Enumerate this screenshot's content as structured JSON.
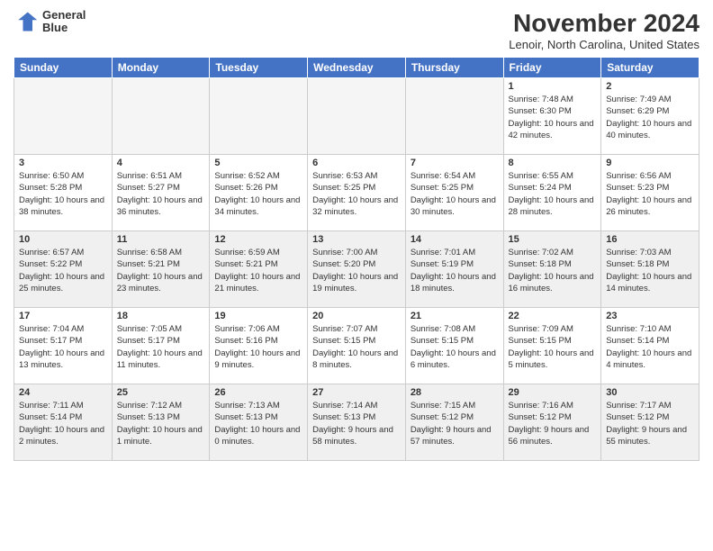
{
  "header": {
    "logo_line1": "General",
    "logo_line2": "Blue",
    "main_title": "November 2024",
    "sub_title": "Lenoir, North Carolina, United States"
  },
  "weekdays": [
    "Sunday",
    "Monday",
    "Tuesday",
    "Wednesday",
    "Thursday",
    "Friday",
    "Saturday"
  ],
  "weeks": [
    [
      {
        "day": "",
        "info": "",
        "empty": true
      },
      {
        "day": "",
        "info": "",
        "empty": true
      },
      {
        "day": "",
        "info": "",
        "empty": true
      },
      {
        "day": "",
        "info": "",
        "empty": true
      },
      {
        "day": "",
        "info": "",
        "empty": true
      },
      {
        "day": "1",
        "info": "Sunrise: 7:48 AM\nSunset: 6:30 PM\nDaylight: 10 hours\nand 42 minutes."
      },
      {
        "day": "2",
        "info": "Sunrise: 7:49 AM\nSunset: 6:29 PM\nDaylight: 10 hours\nand 40 minutes."
      }
    ],
    [
      {
        "day": "3",
        "info": "Sunrise: 6:50 AM\nSunset: 5:28 PM\nDaylight: 10 hours\nand 38 minutes."
      },
      {
        "day": "4",
        "info": "Sunrise: 6:51 AM\nSunset: 5:27 PM\nDaylight: 10 hours\nand 36 minutes."
      },
      {
        "day": "5",
        "info": "Sunrise: 6:52 AM\nSunset: 5:26 PM\nDaylight: 10 hours\nand 34 minutes."
      },
      {
        "day": "6",
        "info": "Sunrise: 6:53 AM\nSunset: 5:25 PM\nDaylight: 10 hours\nand 32 minutes."
      },
      {
        "day": "7",
        "info": "Sunrise: 6:54 AM\nSunset: 5:25 PM\nDaylight: 10 hours\nand 30 minutes."
      },
      {
        "day": "8",
        "info": "Sunrise: 6:55 AM\nSunset: 5:24 PM\nDaylight: 10 hours\nand 28 minutes."
      },
      {
        "day": "9",
        "info": "Sunrise: 6:56 AM\nSunset: 5:23 PM\nDaylight: 10 hours\nand 26 minutes."
      }
    ],
    [
      {
        "day": "10",
        "info": "Sunrise: 6:57 AM\nSunset: 5:22 PM\nDaylight: 10 hours\nand 25 minutes."
      },
      {
        "day": "11",
        "info": "Sunrise: 6:58 AM\nSunset: 5:21 PM\nDaylight: 10 hours\nand 23 minutes."
      },
      {
        "day": "12",
        "info": "Sunrise: 6:59 AM\nSunset: 5:21 PM\nDaylight: 10 hours\nand 21 minutes."
      },
      {
        "day": "13",
        "info": "Sunrise: 7:00 AM\nSunset: 5:20 PM\nDaylight: 10 hours\nand 19 minutes."
      },
      {
        "day": "14",
        "info": "Sunrise: 7:01 AM\nSunset: 5:19 PM\nDaylight: 10 hours\nand 18 minutes."
      },
      {
        "day": "15",
        "info": "Sunrise: 7:02 AM\nSunset: 5:18 PM\nDaylight: 10 hours\nand 16 minutes."
      },
      {
        "day": "16",
        "info": "Sunrise: 7:03 AM\nSunset: 5:18 PM\nDaylight: 10 hours\nand 14 minutes."
      }
    ],
    [
      {
        "day": "17",
        "info": "Sunrise: 7:04 AM\nSunset: 5:17 PM\nDaylight: 10 hours\nand 13 minutes."
      },
      {
        "day": "18",
        "info": "Sunrise: 7:05 AM\nSunset: 5:17 PM\nDaylight: 10 hours\nand 11 minutes."
      },
      {
        "day": "19",
        "info": "Sunrise: 7:06 AM\nSunset: 5:16 PM\nDaylight: 10 hours\nand 9 minutes."
      },
      {
        "day": "20",
        "info": "Sunrise: 7:07 AM\nSunset: 5:15 PM\nDaylight: 10 hours\nand 8 minutes."
      },
      {
        "day": "21",
        "info": "Sunrise: 7:08 AM\nSunset: 5:15 PM\nDaylight: 10 hours\nand 6 minutes."
      },
      {
        "day": "22",
        "info": "Sunrise: 7:09 AM\nSunset: 5:15 PM\nDaylight: 10 hours\nand 5 minutes."
      },
      {
        "day": "23",
        "info": "Sunrise: 7:10 AM\nSunset: 5:14 PM\nDaylight: 10 hours\nand 4 minutes."
      }
    ],
    [
      {
        "day": "24",
        "info": "Sunrise: 7:11 AM\nSunset: 5:14 PM\nDaylight: 10 hours\nand 2 minutes."
      },
      {
        "day": "25",
        "info": "Sunrise: 7:12 AM\nSunset: 5:13 PM\nDaylight: 10 hours\nand 1 minute."
      },
      {
        "day": "26",
        "info": "Sunrise: 7:13 AM\nSunset: 5:13 PM\nDaylight: 10 hours\nand 0 minutes."
      },
      {
        "day": "27",
        "info": "Sunrise: 7:14 AM\nSunset: 5:13 PM\nDaylight: 9 hours\nand 58 minutes."
      },
      {
        "day": "28",
        "info": "Sunrise: 7:15 AM\nSunset: 5:12 PM\nDaylight: 9 hours\nand 57 minutes."
      },
      {
        "day": "29",
        "info": "Sunrise: 7:16 AM\nSunset: 5:12 PM\nDaylight: 9 hours\nand 56 minutes."
      },
      {
        "day": "30",
        "info": "Sunrise: 7:17 AM\nSunset: 5:12 PM\nDaylight: 9 hours\nand 55 minutes."
      }
    ]
  ]
}
